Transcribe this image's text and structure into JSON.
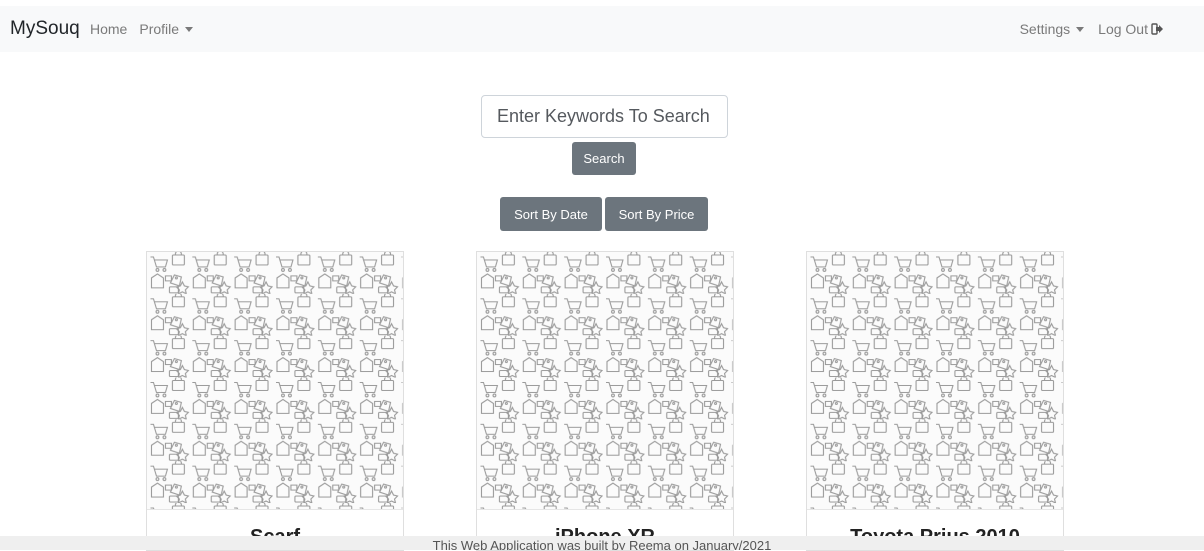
{
  "navbar": {
    "brand": "MySouq",
    "left_links": [
      {
        "label": "Home"
      },
      {
        "label": "Profile"
      }
    ],
    "right_links": [
      {
        "label": "Settings"
      },
      {
        "label": "Log Out"
      }
    ],
    "icons": {
      "dropdown": "caret-down-icon",
      "logout": "sign-out-icon"
    }
  },
  "search": {
    "placeholder": "Enter Keywords To Search",
    "value": "",
    "button_label": "Search"
  },
  "sort": {
    "by_date_label": "Sort By Date",
    "by_price_label": "Sort By Price"
  },
  "products": [
    {
      "title": "Scarf",
      "image_icon": "shopping-pattern-image"
    },
    {
      "title": "iPhone XR",
      "image_icon": "shopping-pattern-image"
    },
    {
      "title": "Toyota Prius 2010",
      "image_icon": "shopping-pattern-image"
    }
  ],
  "footer": {
    "text": "This Web Application was built by Reema on January/2021"
  },
  "colors": {
    "navbar_bg": "#f8f9fa",
    "button_bg": "#6c757d",
    "footer_bg": "#efefef"
  }
}
